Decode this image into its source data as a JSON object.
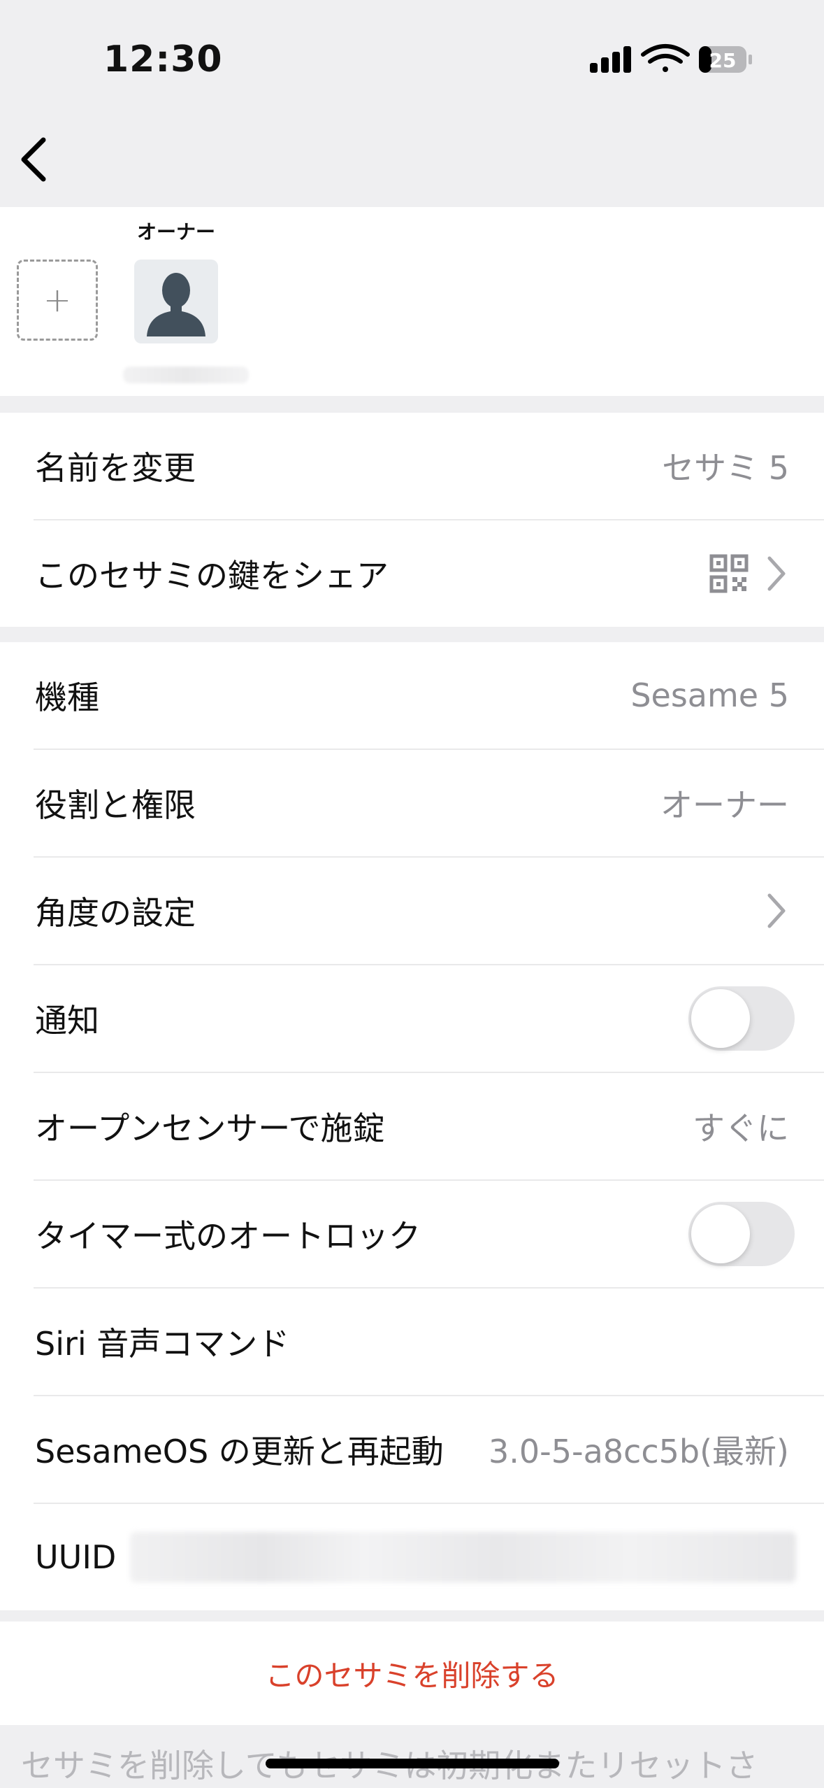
{
  "status_bar": {
    "time": "12:30",
    "battery": "25"
  },
  "members": {
    "owner_label": "オーナー",
    "add_symbol": "+"
  },
  "group1": {
    "rename": {
      "label": "名前を変更",
      "value": "セサミ 5"
    },
    "share": {
      "label": "このセサミの鍵をシェア"
    }
  },
  "group2": {
    "model": {
      "label": "機種",
      "value": "Sesame 5"
    },
    "role": {
      "label": "役割と権限",
      "value": "オーナー"
    },
    "angle": {
      "label": "角度の設定"
    },
    "notify": {
      "label": "通知",
      "on": false
    },
    "open_sensor": {
      "label": "オープンセンサーで施錠",
      "value": "すぐに"
    },
    "auto_lock": {
      "label": "タイマー式のオートロック",
      "on": false
    },
    "siri": {
      "label": "Siri 音声コマンド"
    },
    "os_update": {
      "label": "SesameOS の更新と再起動",
      "value": "3.0-5-a8cc5b(最新)"
    },
    "uuid": {
      "label": "UUID"
    }
  },
  "delete": {
    "label": "このセサミを削除する"
  },
  "footnote": "セサミを削除してもセサミは初期化またリセットさ",
  "colors": {
    "destructive": "#d9412b",
    "secondary_text": "#8e8e93",
    "background": "#efeff1"
  }
}
